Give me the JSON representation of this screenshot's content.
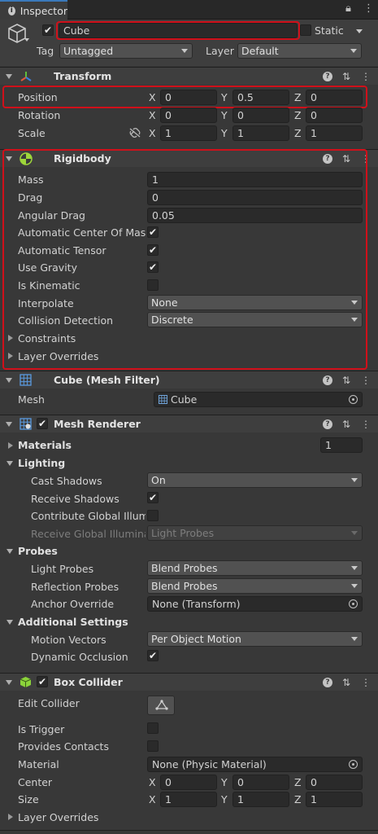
{
  "tab": {
    "label": "Inspector"
  },
  "object": {
    "name": "Cube",
    "static_label": "Static",
    "tag_label": "Tag",
    "tag_value": "Untagged",
    "layer_label": "Layer",
    "layer_value": "Default"
  },
  "transform": {
    "title": "Transform",
    "position": {
      "label": "Position",
      "x": "0",
      "y": "0.5",
      "z": "0"
    },
    "rotation": {
      "label": "Rotation",
      "x": "0",
      "y": "0",
      "z": "0"
    },
    "scale": {
      "label": "Scale",
      "x": "1",
      "y": "1",
      "z": "1"
    }
  },
  "axes": {
    "x": "X",
    "y": "Y",
    "z": "Z"
  },
  "rigidbody": {
    "title": "Rigidbody",
    "mass": {
      "label": "Mass",
      "value": "1"
    },
    "drag": {
      "label": "Drag",
      "value": "0"
    },
    "angular_drag": {
      "label": "Angular Drag",
      "value": "0.05"
    },
    "auto_com": {
      "label": "Automatic Center Of Mass",
      "checked": true
    },
    "auto_tensor": {
      "label": "Automatic Tensor",
      "checked": true
    },
    "use_gravity": {
      "label": "Use Gravity",
      "checked": true
    },
    "is_kinematic": {
      "label": "Is Kinematic",
      "checked": false
    },
    "interpolate": {
      "label": "Interpolate",
      "value": "None"
    },
    "collision_detection": {
      "label": "Collision Detection",
      "value": "Discrete"
    },
    "constraints": {
      "label": "Constraints"
    },
    "layer_overrides": {
      "label": "Layer Overrides"
    }
  },
  "mesh_filter": {
    "title": "Cube (Mesh Filter)",
    "mesh_label": "Mesh",
    "mesh_value": "Cube"
  },
  "mesh_renderer": {
    "title": "Mesh Renderer",
    "materials_label": "Materials",
    "materials_count": "1",
    "lighting_label": "Lighting",
    "cast_shadows": {
      "label": "Cast Shadows",
      "value": "On"
    },
    "receive_shadows": {
      "label": "Receive Shadows",
      "checked": true
    },
    "contribute_gi": {
      "label": "Contribute Global Illumi",
      "checked": false
    },
    "receive_gi": {
      "label": "Receive Global Illumina",
      "value": "Light Probes"
    },
    "probes_label": "Probes",
    "light_probes": {
      "label": "Light Probes",
      "value": "Blend Probes"
    },
    "reflection_probes": {
      "label": "Reflection Probes",
      "value": "Blend Probes"
    },
    "anchor_override": {
      "label": "Anchor Override",
      "value": "None (Transform)"
    },
    "additional_label": "Additional Settings",
    "motion_vectors": {
      "label": "Motion Vectors",
      "value": "Per Object Motion"
    },
    "dynamic_occlusion": {
      "label": "Dynamic Occlusion",
      "checked": true
    }
  },
  "box_collider": {
    "title": "Box Collider",
    "edit_collider": {
      "label": "Edit Collider"
    },
    "is_trigger": {
      "label": "Is Trigger",
      "checked": false
    },
    "provides_contacts": {
      "label": "Provides Contacts",
      "checked": false
    },
    "material": {
      "label": "Material",
      "value": "None (Physic Material)"
    },
    "center": {
      "label": "Center",
      "x": "0",
      "y": "0",
      "z": "0"
    },
    "size": {
      "label": "Size",
      "x": "1",
      "y": "1",
      "z": "1"
    },
    "layer_overrides": {
      "label": "Layer Overrides"
    }
  },
  "colors": {
    "highlight": "#d0101a",
    "background": "#383838",
    "field": "#2a2a2a"
  }
}
